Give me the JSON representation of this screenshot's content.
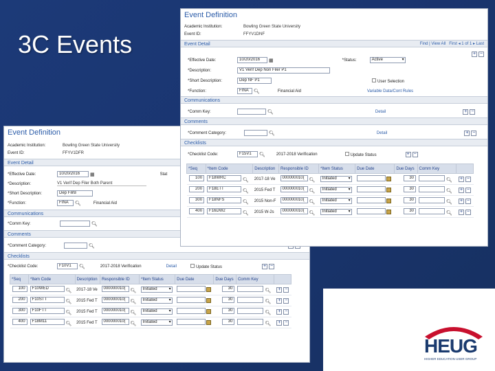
{
  "slide_title": "3C Events",
  "logo": {
    "text": "HEUG",
    "subtitle": "HIGHER EDUCATION USER GROUP",
    "tm": "TM",
    "arc_color": "#c8102e"
  },
  "back": {
    "title": "Event Definition",
    "institution_label": "Academic Institution:",
    "institution_value": "Bowling Green State University",
    "event_id_label": "Event ID:",
    "event_id_value": "FFYV1DFR",
    "event_detail": "Event Detail",
    "eff_date_label": "*Effective Date:",
    "eff_date_value": "10/20/2016",
    "status_label": "Stat",
    "desc_label": "*Description:",
    "desc_value": "V1 Verif Dep Filer Both Parent",
    "short_label": "*Short Description:",
    "short_value": "Dep FilrB",
    "function_label": "*Function:",
    "function_value": "FINA",
    "function_text": "Financial Aid",
    "communications": "Communications",
    "comm_key_label": "*Comm Key:",
    "comments": "Comments",
    "comment_cat_label": "*Comment Category:",
    "detail": "Detail",
    "checklists": "Checklists",
    "checklist_code_label": "*Checklist Code:",
    "checklist_code_value": "F10V1",
    "checklist_desc": "2017-2018 Verification",
    "update_status": "Update Status",
    "headers": [
      "*Seq",
      "*Item Code",
      "Description",
      "Responsible ID",
      "*Item Status",
      "Due Date",
      "Due Days",
      "Comm Key"
    ],
    "rows": [
      {
        "seq": "100",
        "item": "F10WED",
        "desc": "2017-18 Ve",
        "rid": "000000010(",
        "status": "Initiated",
        "days": "30"
      },
      {
        "seq": "200",
        "item": "F10STT",
        "desc": "2015 Fed T",
        "rid": "000000010(",
        "status": "Initiated",
        "days": "30"
      },
      {
        "seq": "300",
        "item": "F10FTT",
        "desc": "2015 Fed T",
        "rid": "000000010(",
        "status": "Initiated",
        "days": "30"
      },
      {
        "seq": "400",
        "item": "F18M11",
        "desc": "2015 Fed T",
        "rid": "000000010(",
        "status": "Initiated",
        "days": "30"
      }
    ]
  },
  "front": {
    "title": "Event Definition",
    "institution_label": "Academic Institution:",
    "institution_value": "Bowling Green State University",
    "event_id_label": "Event ID:",
    "event_id_value": "FFYV1DNF",
    "event_detail": "Event Detail",
    "nav_find": "Find",
    "nav_view_all": "View All",
    "nav_first": "First",
    "nav_count": "1 of 1",
    "nav_last": "Last",
    "eff_date_label": "*Effective Date:",
    "eff_date_value": "10/20/2016",
    "status_label": "*Status:",
    "status_value": "Active",
    "desc_label": "*Description:",
    "desc_value": "V1 Verif Dep Non Filer P1",
    "short_label": "*Short Description:",
    "short_value": "Dep NF P1",
    "user_selection": "User Selection",
    "function_label": "*Function:",
    "function_value": "FINA",
    "function_text": "Financial Aid",
    "variable_data": "Variable Data/Cont Rules",
    "communications": "Communications",
    "comm_key_label": "*Comm Key:",
    "comments": "Comments",
    "comment_cat_label": "*Comment Category:",
    "detail": "Detail",
    "checklists": "Checklists",
    "checklist_code_label": "*Checklist Code:",
    "checklist_code_value": "F15V1",
    "checklist_desc": "2017-2018 Verification",
    "update_status": "Update Status",
    "headers": [
      "*Seq",
      "*Item Code",
      "Description",
      "Responsible ID",
      "*Item Status",
      "Due Date",
      "Due Days",
      "Comm Key"
    ],
    "rows": [
      {
        "seq": "100",
        "item": "F18WRC",
        "desc": "2017-18 Ve",
        "rid": "000000010(",
        "status": "Initiated",
        "days": "30"
      },
      {
        "seq": "200",
        "item": "F18ETT",
        "desc": "2015 Fed T",
        "rid": "000000010(",
        "status": "Initiated",
        "days": "30"
      },
      {
        "seq": "300",
        "item": "F18NFS",
        "desc": "2015 Non-F",
        "rid": "000000010(",
        "status": "Initiated",
        "days": "30"
      },
      {
        "seq": "400",
        "item": "F16DW2",
        "desc": "2015 W-2s",
        "rid": "000000010(",
        "status": "Initiated",
        "days": "30"
      }
    ]
  }
}
